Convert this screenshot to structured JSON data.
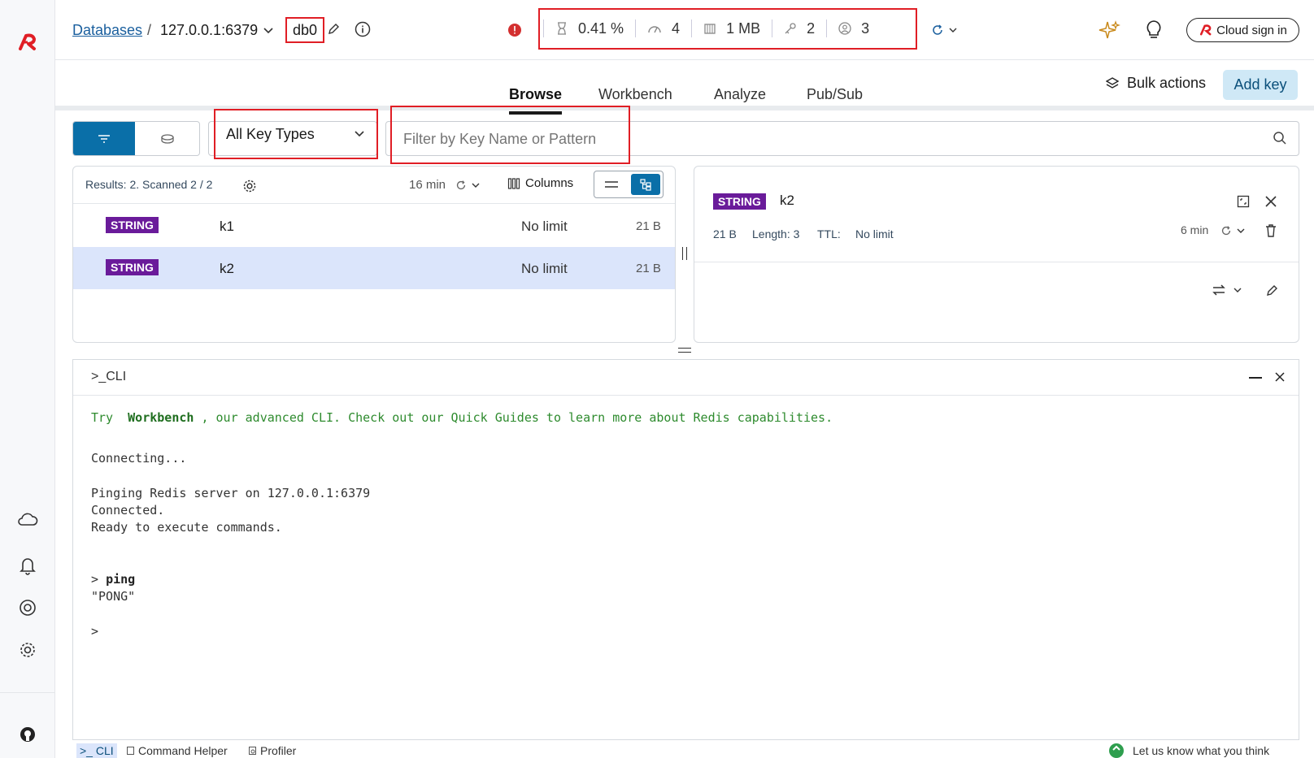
{
  "header": {
    "breadcrumb_databases": "Databases",
    "breadcrumb_sep": "/",
    "host": "127.0.0.1:6379",
    "db": "db0",
    "stats": {
      "cpu": "0.41 %",
      "ops": "4",
      "memory": "1 MB",
      "keys": "2",
      "clients": "3"
    },
    "cloud_sign_in": "Cloud sign in"
  },
  "tabs": [
    "Browse",
    "Workbench",
    "Analyze",
    "Pub/Sub"
  ],
  "actions": {
    "bulk_actions": "Bulk actions",
    "add_key": "Add key"
  },
  "filter": {
    "key_type": "All Key Types",
    "search_placeholder": "Filter by Key Name or Pattern"
  },
  "results": {
    "summary": "Results: 2. Scanned 2 / 2",
    "refresh_time": "16 min",
    "columns_label": "Columns",
    "rows": [
      {
        "type": "STRING",
        "name": "k1",
        "ttl": "No limit",
        "size": "21 B"
      },
      {
        "type": "STRING",
        "name": "k2",
        "ttl": "No limit",
        "size": "21 B"
      }
    ]
  },
  "details": {
    "type": "STRING",
    "name": "k2",
    "size": "21 B",
    "length": "Length: 3",
    "ttl_label": "TTL:",
    "ttl_value": "No limit",
    "refresh_time": "6 min"
  },
  "cli": {
    "title": ">_CLI",
    "intro_try": "Try",
    "intro_workbench": "Workbench",
    "intro_rest": ", our advanced CLI. Check out our Quick Guides to learn more about Redis capabilities.",
    "connecting": "Connecting...",
    "pinging": "Pinging Redis server on 127.0.0.1:6379",
    "connected": "Connected.",
    "ready": "Ready to execute commands.",
    "cmd_prompt": ">",
    "cmd": "ping",
    "response": "\"PONG\"",
    "prompt": ">"
  },
  "footer": {
    "cli": ">_ CLI",
    "command_helper": "Command Helper",
    "profiler": "Profiler",
    "feedback": "Let us know what you think"
  },
  "colors": {
    "accent": "#0a6fa8",
    "string_badge": "#6a1b9a",
    "selected_row": "#dbe5fb",
    "cli_green": "#2e8b2e",
    "red_box": "#e01e25"
  }
}
